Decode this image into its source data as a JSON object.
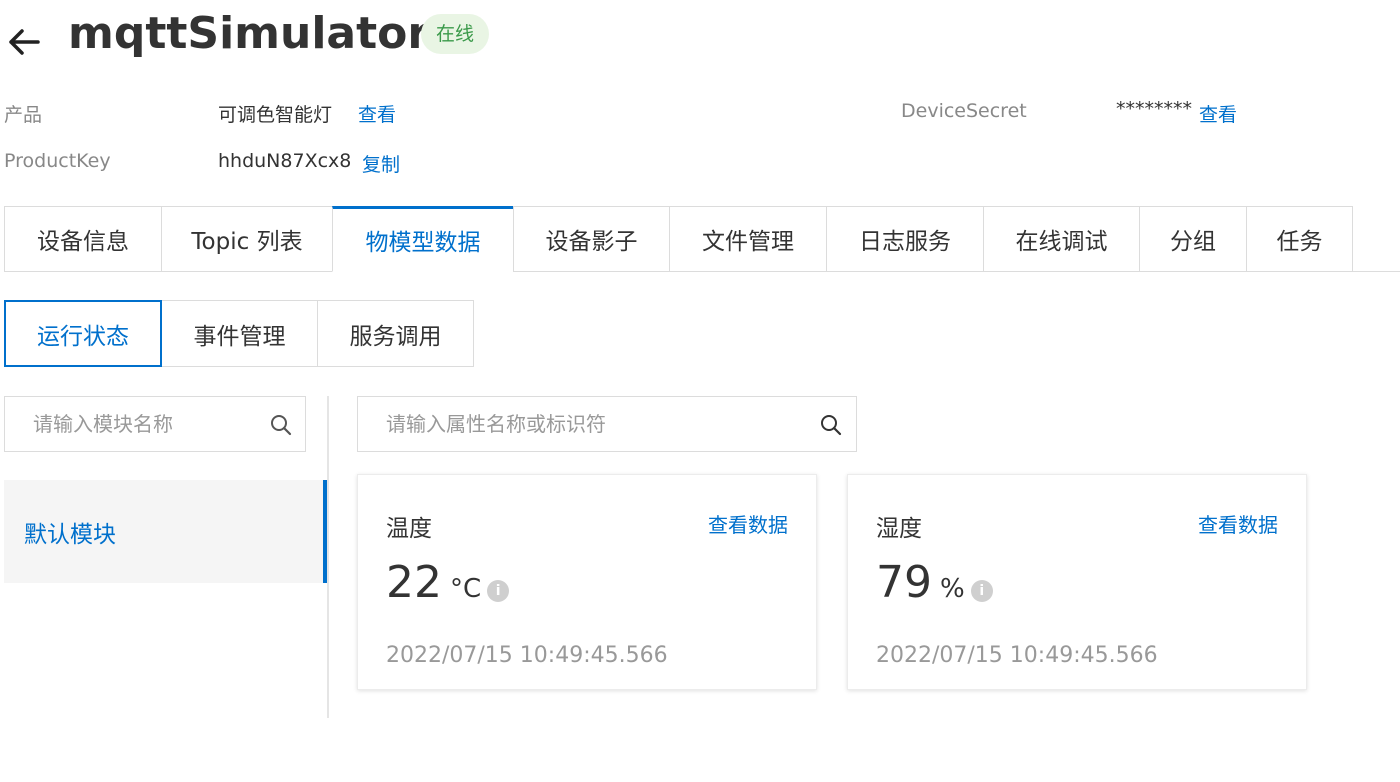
{
  "header": {
    "title": "mqttSimulator",
    "status": "在线"
  },
  "info": {
    "product_label": "产品",
    "product_value": "可调色智能灯",
    "product_link": "查看",
    "productkey_label": "ProductKey",
    "productkey_value": "hhduN87Xcx8",
    "productkey_link": "复制",
    "secret_label": "DeviceSecret",
    "secret_value": "********",
    "secret_link": "查看"
  },
  "main_tabs": [
    {
      "label": "设备信息"
    },
    {
      "label": "Topic 列表"
    },
    {
      "label": "物模型数据",
      "active": true
    },
    {
      "label": "设备影子"
    },
    {
      "label": "文件管理"
    },
    {
      "label": "日志服务"
    },
    {
      "label": "在线调试"
    },
    {
      "label": "分组"
    },
    {
      "label": "任务"
    }
  ],
  "sub_tabs": [
    {
      "label": "运行状态",
      "active": true
    },
    {
      "label": "事件管理"
    },
    {
      "label": "服务调用"
    }
  ],
  "module_search": {
    "placeholder": "请输入模块名称",
    "value": ""
  },
  "property_search": {
    "placeholder": "请输入属性名称或标识符",
    "value": ""
  },
  "modules": [
    {
      "label": "默认模块",
      "active": true
    }
  ],
  "properties": [
    {
      "name": "温度",
      "link": "查看数据",
      "value": "22",
      "unit": "°C",
      "time": "2022/07/15 10:49:45.566"
    },
    {
      "name": "湿度",
      "link": "查看数据",
      "value": "79",
      "unit": "%",
      "time": "2022/07/15 10:49:45.566"
    }
  ],
  "colors": {
    "accent": "#0070cc",
    "online_bg": "#e9f5e4",
    "online_text": "#3b9a4a"
  }
}
